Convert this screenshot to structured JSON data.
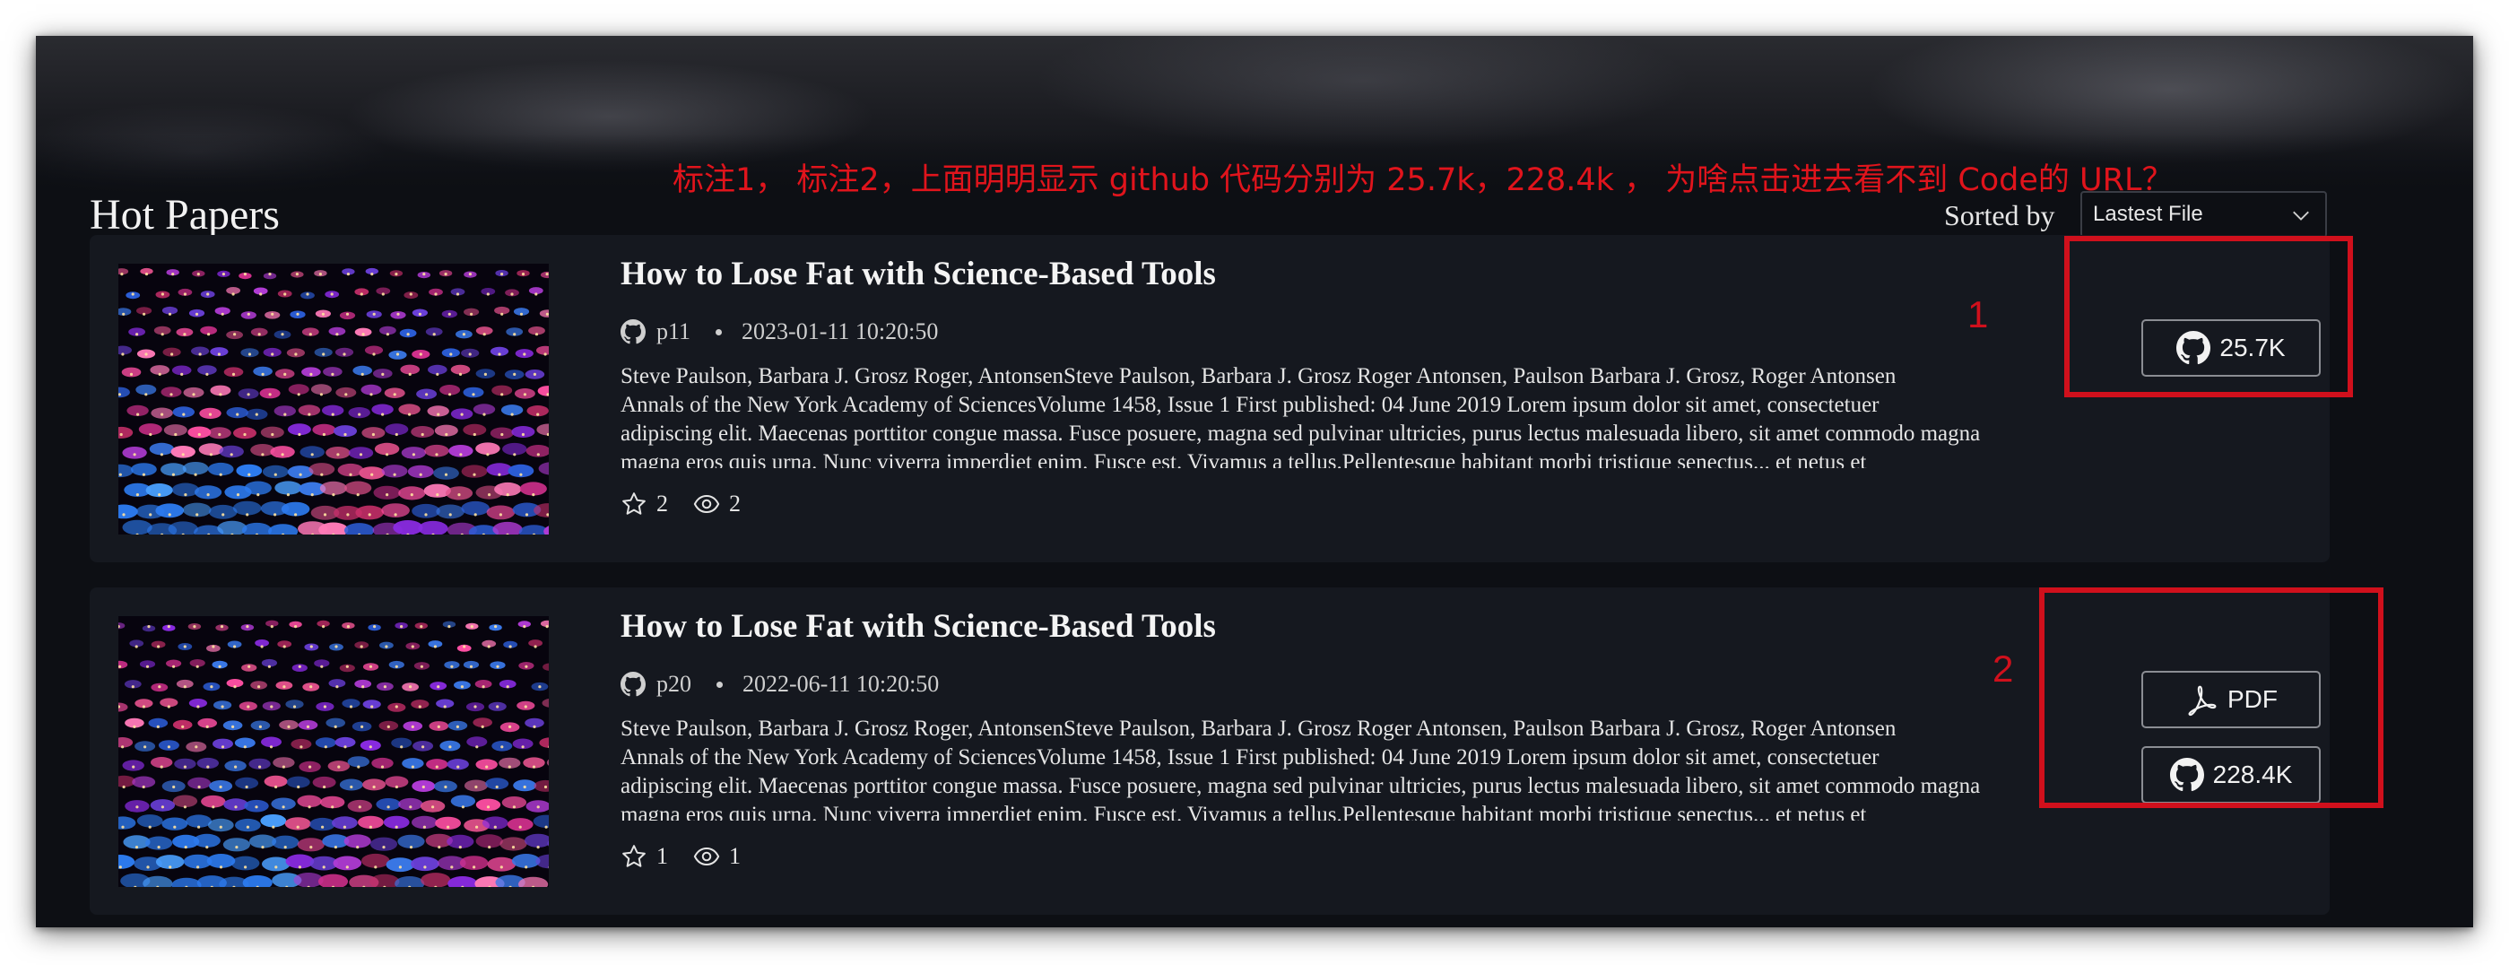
{
  "annotation_note": "标注1， 标注2，上面明明显示 github 代码分别为 25.7k，228.4k ， 为啥点击进去看不到 Code的 URL？",
  "section": {
    "title": "Hot Papers"
  },
  "sort": {
    "label": "Sorted by",
    "selected": "Lastest File"
  },
  "papers": [
    {
      "title": "How to Lose Fat with Science-Based Tools",
      "user": "p11",
      "date": "2023-01-11 10:20:50",
      "abstract_lines": [
        "Steve Paulson, Barbara J. Grosz Roger, AntonsenSteve Paulson, Barbara J. Grosz Roger Antonsen, Paulson Barbara J. Grosz, Roger Antonsen",
        "Annals of the New York Academy of SciencesVolume 1458, Issue 1 First published: 04 June 2019 Lorem ipsum dolor sit amet, consectetuer",
        "adipiscing elit. Maecenas porttitor congue massa. Fusce posuere, magna sed pulvinar ultricies, purus lectus malesuada libero, sit amet commodo magna",
        "magna eros quis urna. Nunc viverra imperdiet enim. Fusce est. Vivamus a tellus.Pellentesque habitant morbi tristique senectus... et netus et"
      ],
      "stars": "2",
      "views": "2",
      "github_count": "25.7K",
      "annotation_number": "1"
    },
    {
      "title": "How to Lose Fat with Science-Based Tools",
      "user": "p20",
      "date": "2022-06-11 10:20:50",
      "abstract_lines": [
        "Steve Paulson, Barbara J. Grosz Roger, AntonsenSteve Paulson, Barbara J. Grosz Roger Antonsen, Paulson Barbara J. Grosz, Roger Antonsen",
        "Annals of the New York Academy of SciencesVolume 1458, Issue 1 First published: 04 June 2019 Lorem ipsum dolor sit amet, consectetuer",
        "adipiscing elit. Maecenas porttitor congue massa. Fusce posuere, magna sed pulvinar ultricies, purus lectus malesuada libero, sit amet commodo magna",
        "magna eros quis urna. Nunc viverra imperdiet enim. Fusce est. Vivamus a tellus.Pellentesque habitant morbi tristique senectus... et netus et"
      ],
      "stars": "1",
      "views": "1",
      "pdf_label": "PDF",
      "github_count": "228.4K",
      "annotation_number": "2"
    }
  ],
  "colors": {
    "page_bg": "#0d0f14",
    "card_bg": "#15181f",
    "annotation_red": "#d0101c"
  },
  "icons": {
    "github": "github-icon",
    "pdf": "pdf-icon",
    "star": "star-icon",
    "eye": "eye-icon",
    "chevron": "chevron-down-icon"
  }
}
